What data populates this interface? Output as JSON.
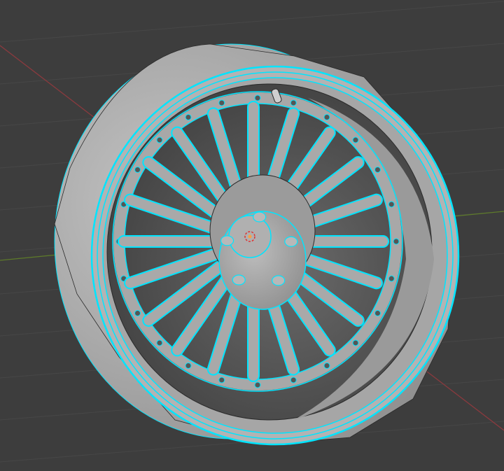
{
  "viewport": {
    "background": "#3d3d3d",
    "grid_color": "#474747",
    "x_axis_color": "#8a3a3e",
    "y_axis_color": "#5d7a2a"
  },
  "mesh": {
    "object": "wheel",
    "spoke_count": 20,
    "lug_count": 5,
    "bolt_count": 24,
    "surface_color": "#a9a9a9",
    "selection_edge_color": "#00e5ff",
    "wire_color": "#2a2a2a"
  }
}
